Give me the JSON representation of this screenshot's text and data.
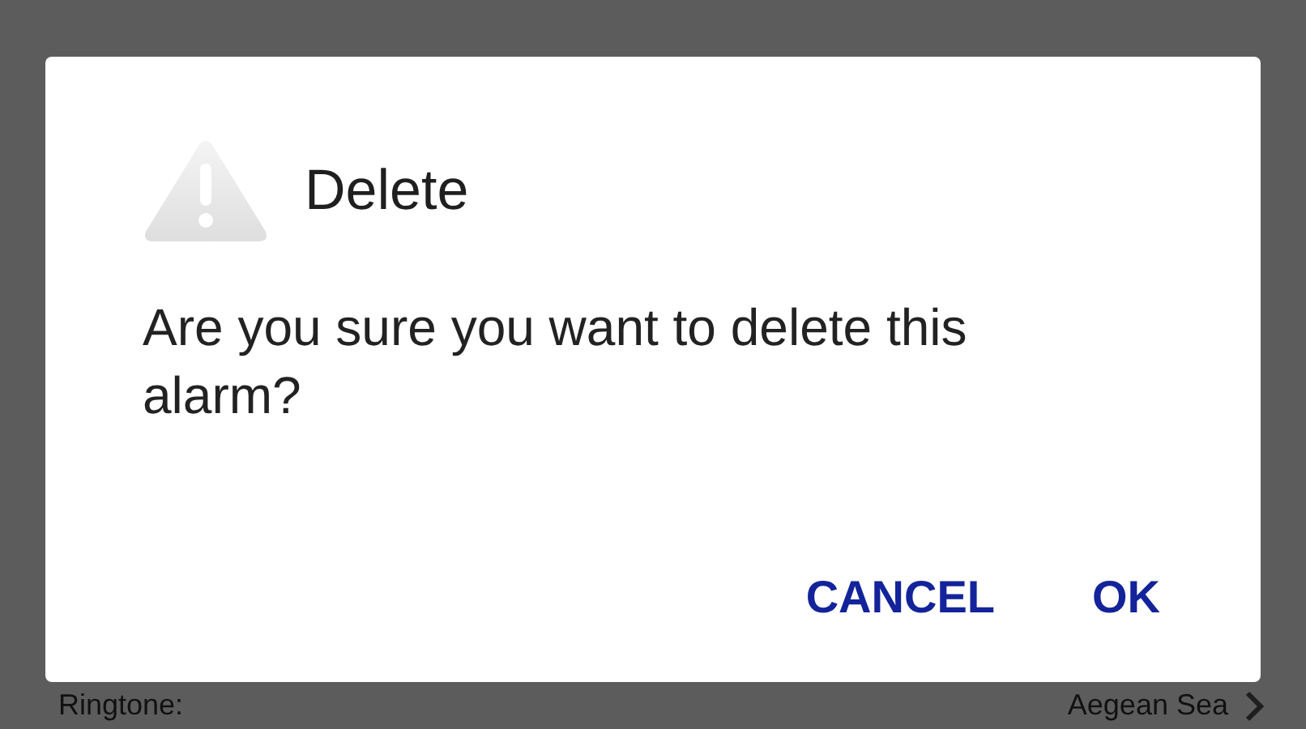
{
  "background": {
    "setting": {
      "label": "Ringtone:",
      "value": "Aegean Sea"
    }
  },
  "dialog": {
    "title": "Delete",
    "message": "Are you sure you want to delete this alarm?",
    "buttons": [
      {
        "label": "CANCEL"
      },
      {
        "label": "OK"
      }
    ]
  }
}
